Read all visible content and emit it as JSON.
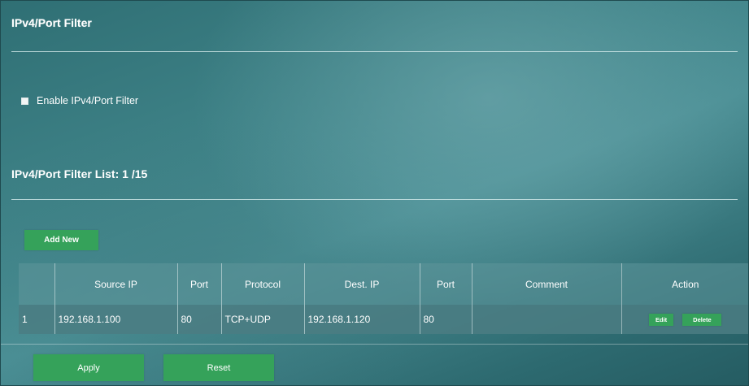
{
  "page": {
    "title": "IPv4/Port Filter",
    "enable_label": "Enable IPv4/Port Filter",
    "enable_checked": false,
    "list_title": "IPv4/Port Filter List: 1 /15"
  },
  "buttons": {
    "add_new": "Add New",
    "apply": "Apply",
    "reset": "Reset"
  },
  "table": {
    "headers": {
      "index": "",
      "source_ip": "Source IP",
      "port": "Port",
      "protocol": "Protocol",
      "dest_ip": "Dest. IP",
      "dest_port": "Port",
      "comment": "Comment",
      "action": "Action"
    },
    "rows": [
      {
        "index": "1",
        "source_ip": "192.168.1.100",
        "port": "80",
        "protocol": "TCP+UDP",
        "dest_ip": "192.168.1.120",
        "dest_port": "80",
        "comment": "",
        "edit_label": "Edit",
        "delete_label": "Delete"
      }
    ]
  },
  "colors": {
    "background": "#3f8388",
    "button": "#35a25a",
    "text": "#ffffff"
  }
}
